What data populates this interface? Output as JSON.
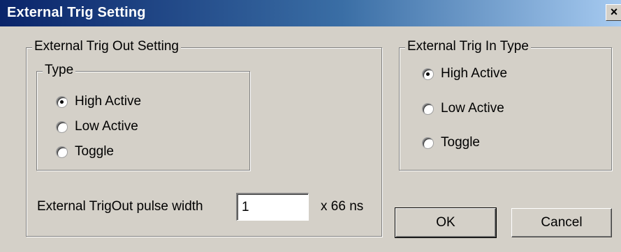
{
  "window": {
    "title": "External Trig Setting",
    "close_glyph": "×"
  },
  "trig_out": {
    "group_label": "External Trig Out Setting",
    "type_group_label": "Type",
    "options": [
      {
        "label": "High Active",
        "checked": true
      },
      {
        "label": "Low Active",
        "checked": false
      },
      {
        "label": "Toggle",
        "checked": false
      }
    ],
    "pulse_width_label": "External TrigOut pulse width",
    "pulse_width_value": "1",
    "pulse_width_unit": "x 66 ns"
  },
  "trig_in": {
    "group_label": "External Trig In Type",
    "options": [
      {
        "label": "High Active",
        "checked": true
      },
      {
        "label": "Low Active",
        "checked": false
      },
      {
        "label": "Toggle",
        "checked": false
      }
    ]
  },
  "buttons": {
    "ok_label": "OK",
    "cancel_label": "Cancel"
  }
}
